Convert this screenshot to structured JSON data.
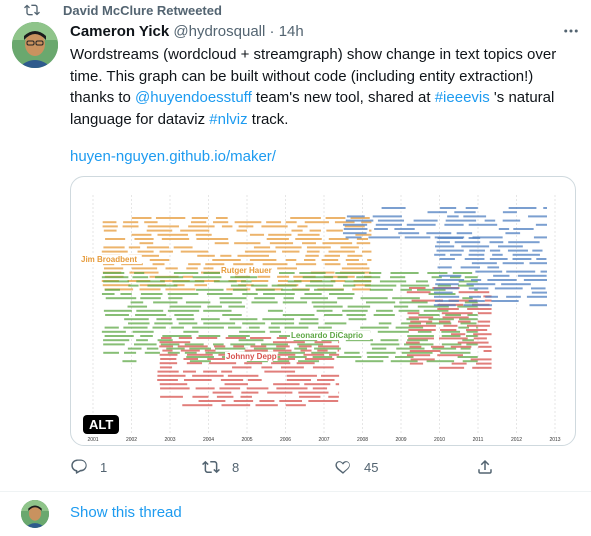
{
  "retweet": {
    "label": "David McClure Retweeted"
  },
  "tweet": {
    "author_name": "Cameron Yick",
    "handle": "@hydrosquall",
    "separator": "·",
    "time": "14h",
    "text_1": "Wordstreams (wordcloud + streamgraph) show change  in text topics over time. This graph can be built without code (including entity extraction!) thanks to ",
    "mention": "@huyendoesstuff",
    "text_2": " team's new tool, shared at ",
    "hashtag_1": "#ieeevis",
    "text_3": " 's natural language for dataviz ",
    "hashtag_2": "#nlviz",
    "text_4": " track.",
    "link": "huyen-nguyen.github.io/maker/"
  },
  "media": {
    "alt_badge": "ALT",
    "years": [
      "2001",
      "2002",
      "2003",
      "2004",
      "2005",
      "2006",
      "2007",
      "2008",
      "2009",
      "2010",
      "2011",
      "2012",
      "2013"
    ],
    "highlighted_words": [
      "Jim Broadbent",
      "Rutger Hauer",
      "Leonardo DiCaprio",
      "Johnny Depp"
    ],
    "colors": {
      "orange": "#e69b3b",
      "green": "#5fa847",
      "red": "#d7534f",
      "blue": "#4f7fc0"
    }
  },
  "actions": {
    "replies": "1",
    "retweets": "8",
    "likes": "45"
  },
  "thread": {
    "label": "Show this thread"
  }
}
